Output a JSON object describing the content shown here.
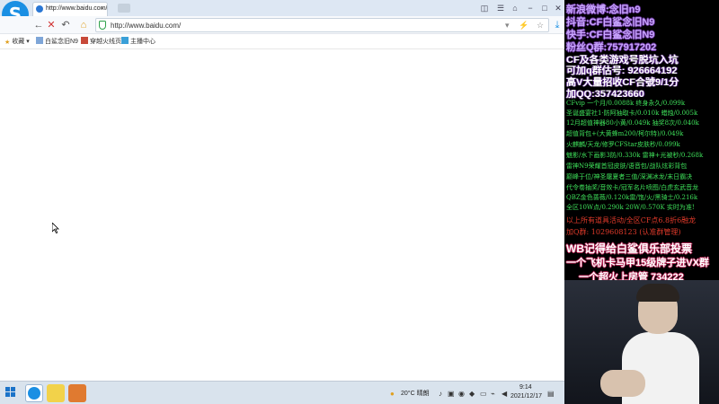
{
  "browser": {
    "tab_title": "http://www.baidu.com/",
    "address_url": "http://www.baidu.com/",
    "favorites": [
      {
        "label": "收藏",
        "icon": "star-icon"
      },
      {
        "label": "白鲨念旧N9",
        "icon": "page-icon"
      },
      {
        "label": "穿越火线页",
        "icon": "game-icon"
      },
      {
        "label": "主播中心",
        "icon": "anchor-icon"
      }
    ]
  },
  "taskbar": {
    "weather": "20°C 晴朗",
    "time": "9:14",
    "date": "2021/12/17"
  },
  "overlay": {
    "lines_big": [
      "新浪微博:念旧n9",
      "抖音:CF白鲨念旧N9",
      "快手:CF白鲨念旧N9",
      "粉丝Q群:757917202",
      "CF及各类游戏号脱坑入坑",
      "可加q群估号: 926664192",
      "高V大量招收CF合號9/1分",
      "加QQ:357423660"
    ],
    "lines_small": [
      "CFvip 一个月/0.0088k  终身永久/0.099k",
      "圣诞盛宴社1·防阿抽取卡/0.010k 蜡烛/0.005k",
      "12月超值神器80小黄/0.049k 抽奖8次/0.040k",
      "超值背包+(大黄蜂m200/柯尔特)/0.049k",
      "火麒麟/天龙/修罗CFStar皮肤秒/0.099k",
      "魅影/水下画影3防/0.330k 雷神+光被秒/0.268k",
      "雷神N9荣耀首冠皮肤/语音包/战队炫彩背包",
      "巅峰于位/神圣屠夏者三值/深渊冰龙/末日霸决",
      "代令卷抽奖/音效卡/冠军名片喷图/白虎玄武音龙",
      "QBZ金色蔷薇/0.120k雷/饱/火/黑骑士/0.216k",
      "全区10W点/0.290k 20W/0.570K 实时为准!"
    ],
    "lines_red": [
      "以上所有道具活动/全区CF点6.8折6融龙",
      "加Q群: 1029608123 (认准群管理)"
    ],
    "banner": [
      "WB记得给白鲨俱乐部投票",
      "一个飞机卡马甲15级牌子进VX群",
      "一个超火上房管 734222"
    ]
  },
  "colors": {
    "overlay_big_text": "#c9a6ff",
    "overlay_small_text": "#3ee05a",
    "overlay_red_text": "#e03a2a",
    "taskbar_bg": "#d9e3ed",
    "titlebar_bg": "#dde7f3"
  }
}
